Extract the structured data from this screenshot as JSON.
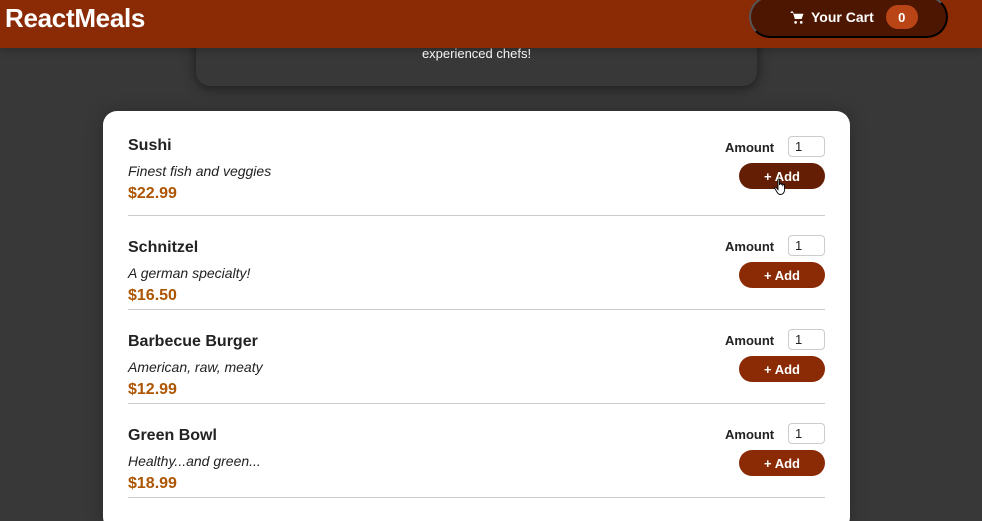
{
  "header": {
    "logo": "ReactMeals",
    "cart": {
      "label": "Your Cart",
      "count": "0",
      "icon": "cart-icon"
    }
  },
  "summary": {
    "text": "experienced chefs!"
  },
  "meals": [
    {
      "name": "Sushi",
      "description": "Finest fish and veggies",
      "price": "$22.99",
      "amount_label": "Amount",
      "amount_value": "1",
      "add_label": "+ Add"
    },
    {
      "name": "Schnitzel",
      "description": "A german specialty!",
      "price": "$16.50",
      "amount_label": "Amount",
      "amount_value": "1",
      "add_label": "+ Add"
    },
    {
      "name": "Barbecue Burger",
      "description": "American, raw, meaty",
      "price": "$12.99",
      "amount_label": "Amount",
      "amount_value": "1",
      "add_label": "+ Add"
    },
    {
      "name": "Green Bowl",
      "description": "Healthy...and green...",
      "price": "$18.99",
      "amount_label": "Amount",
      "amount_value": "1",
      "add_label": "+ Add"
    }
  ],
  "colors": {
    "header": "#8a2b06",
    "cart_button": "#4d1601",
    "badge": "#b94517",
    "price": "#ad5502",
    "background": "#383838"
  }
}
